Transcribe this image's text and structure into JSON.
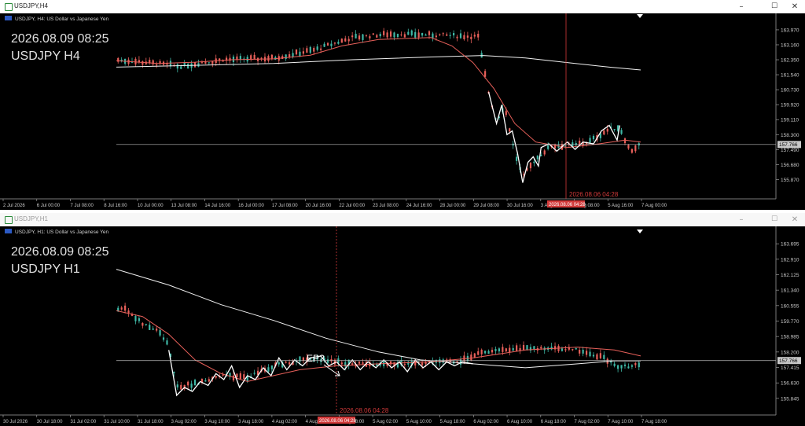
{
  "windows": [
    {
      "id": "h4",
      "window_title": "USDJPY,H4",
      "chart_header": "USDJPY, H4:  US Dollar vs Japanese Yen",
      "overlay_date": "2026.08.09 08:25",
      "overlay_symbol": "USDJPY H4",
      "crosshair_label": "2026.08.06 04:28",
      "crosshair_time_tag": "2026.08.06 04:28",
      "current_price": "157.766",
      "controls": {
        "minimize": "–",
        "maximize": "☐",
        "close": "✕"
      },
      "chart_data": {
        "type": "candlestick",
        "price_ticks": [
          "163.970",
          "163.160",
          "162.350",
          "161.540",
          "160.730",
          "159.920",
          "159.110",
          "158.300",
          "157.490",
          "156.680",
          "155.870"
        ],
        "ylim": [
          155.25,
          164.35
        ],
        "time_ticks": [
          "2 Jul 2026",
          "6 Jul 00:00",
          "7 Jul 08:00",
          "8 Jul 16:00",
          "10 Jul 00:00",
          "13 Jul 08:00",
          "14 Jul 16:00",
          "16 Jul 00:00",
          "17 Jul 08:00",
          "20 Jul 16:00",
          "22 Jul 00:00",
          "23 Jul 08:00",
          "24 Jul 16:00",
          "28 Jul 00:00",
          "29 Jul 08:00",
          "30 Jul 16:00",
          "3 Aug 00:00",
          "4 Aug 08:00",
          "5 Aug 16:00",
          "7 Aug 00:00"
        ],
        "price_line": 157.766,
        "series": [
          {
            "name": "",
            "type": "sma",
            "color": "#f0f0f0",
            "points": [
              [
                0,
                161.95
              ],
              [
                0.15,
                162.05
              ],
              [
                0.3,
                162.15
              ],
              [
                0.45,
                162.35
              ],
              [
                0.6,
                162.5
              ],
              [
                0.7,
                162.58
              ],
              [
                0.78,
                162.45
              ],
              [
                0.86,
                162.2
              ],
              [
                0.94,
                161.95
              ],
              [
                1,
                161.8
              ]
            ]
          },
          {
            "name": "",
            "type": "ema",
            "color": "#e8605a",
            "points": [
              [
                0,
                162.3
              ],
              [
                0.08,
                162.15
              ],
              [
                0.15,
                162.22
              ],
              [
                0.22,
                162.35
              ],
              [
                0.3,
                162.4
              ],
              [
                0.37,
                162.6
              ],
              [
                0.43,
                163.1
              ],
              [
                0.5,
                163.45
              ],
              [
                0.6,
                163.55
              ],
              [
                0.64,
                163.1
              ],
              [
                0.68,
                162.2
              ],
              [
                0.72,
                160.8
              ],
              [
                0.76,
                158.9
              ],
              [
                0.8,
                157.9
              ],
              [
                0.86,
                157.6
              ],
              [
                0.92,
                157.8
              ],
              [
                0.97,
                158.0
              ],
              [
                1,
                157.9
              ]
            ]
          },
          {
            "name": "",
            "type": "zigzag",
            "color": "#ffffff",
            "points": [
              [
                0.71,
                160.6
              ],
              [
                0.725,
                158.9
              ],
              [
                0.735,
                159.9
              ],
              [
                0.745,
                158.3
              ],
              [
                0.755,
                158.5
              ],
              [
                0.765,
                157.3
              ],
              [
                0.775,
                155.7
              ],
              [
                0.785,
                156.8
              ],
              [
                0.795,
                157.1
              ],
              [
                0.805,
                156.6
              ],
              [
                0.81,
                157.6
              ],
              [
                0.825,
                157.8
              ],
              [
                0.84,
                157.4
              ],
              [
                0.86,
                157.9
              ],
              [
                0.875,
                157.5
              ],
              [
                0.89,
                157.9
              ],
              [
                0.91,
                157.8
              ],
              [
                0.925,
                158.5
              ],
              [
                0.94,
                158.8
              ],
              [
                0.955,
                158.0
              ],
              [
                0.96,
                158.8
              ]
            ]
          }
        ]
      }
    },
    {
      "id": "h1",
      "window_title": "USDJPY,H1",
      "chart_header": "USDJPY, H1:  US Dollar vs Japanese Yen",
      "overlay_date": "2026.08.09 08:25",
      "overlay_symbol": "USDJPY H1",
      "crosshair_label": "2026.08.06 04:28",
      "crosshair_time_tag": "2026.08.06 04:28",
      "annotation": "EP?",
      "current_price": "157.766",
      "controls": {
        "minimize": "–",
        "maximize": "☐",
        "close": "✕"
      },
      "chart_data": {
        "type": "candlestick",
        "price_ticks": [
          "163.695",
          "162.910",
          "162.125",
          "161.340",
          "160.555",
          "159.770",
          "158.985",
          "158.200",
          "157.415",
          "156.630",
          "155.845"
        ],
        "ylim": [
          155.4,
          164.1
        ],
        "time_ticks": [
          "30 Jul 2026",
          "30 Jul 18:00",
          "31 Jul 02:00",
          "31 Jul 10:00",
          "31 Jul 18:00",
          "3 Aug 02:00",
          "3 Aug 10:00",
          "3 Aug 18:00",
          "4 Aug 02:00",
          "4 Aug 10:00",
          "4 Aug 18:00",
          "5 Aug 02:00",
          "5 Aug 10:00",
          "5 Aug 18:00",
          "6 Aug 02:00",
          "6 Aug 10:00",
          "6 Aug 18:00",
          "7 Aug 02:00",
          "7 Aug 10:00",
          "7 Aug 18:00"
        ],
        "price_line": 157.766,
        "series": [
          {
            "name": "",
            "type": "sma",
            "color": "#f0f0f0",
            "points": [
              [
                0,
                162.4
              ],
              [
                0.1,
                161.6
              ],
              [
                0.2,
                160.6
              ],
              [
                0.3,
                159.8
              ],
              [
                0.4,
                158.9
              ],
              [
                0.5,
                158.2
              ],
              [
                0.58,
                157.8
              ],
              [
                0.68,
                157.6
              ],
              [
                0.78,
                157.4
              ],
              [
                0.88,
                157.6
              ],
              [
                0.95,
                157.75
              ],
              [
                1,
                157.75
              ]
            ]
          },
          {
            "name": "",
            "type": "ema",
            "color": "#e8605a",
            "points": [
              [
                0,
                160.3
              ],
              [
                0.05,
                160.0
              ],
              [
                0.1,
                159.1
              ],
              [
                0.15,
                157.8
              ],
              [
                0.2,
                157.1
              ],
              [
                0.25,
                156.7
              ],
              [
                0.3,
                157.0
              ],
              [
                0.35,
                157.3
              ],
              [
                0.42,
                157.5
              ],
              [
                0.5,
                157.6
              ],
              [
                0.6,
                157.7
              ],
              [
                0.68,
                157.9
              ],
              [
                0.78,
                158.3
              ],
              [
                0.88,
                158.45
              ],
              [
                0.95,
                158.3
              ],
              [
                1,
                158.0
              ]
            ]
          },
          {
            "name": "",
            "type": "zigzag",
            "color": "#ffffff",
            "points": [
              [
                0.1,
                158.3
              ],
              [
                0.115,
                156.0
              ],
              [
                0.13,
                156.4
              ],
              [
                0.145,
                156.2
              ],
              [
                0.16,
                156.7
              ],
              [
                0.175,
                156.5
              ],
              [
                0.19,
                157.1
              ],
              [
                0.205,
                156.8
              ],
              [
                0.22,
                157.5
              ],
              [
                0.235,
                156.4
              ],
              [
                0.25,
                157.0
              ],
              [
                0.265,
                156.8
              ],
              [
                0.28,
                157.4
              ],
              [
                0.295,
                157.0
              ],
              [
                0.31,
                157.9
              ],
              [
                0.325,
                157.3
              ],
              [
                0.34,
                157.8
              ],
              [
                0.355,
                157.5
              ],
              [
                0.37,
                157.9
              ],
              [
                0.39,
                158.0
              ],
              [
                0.405,
                157.5
              ],
              [
                0.42,
                157.7
              ],
              [
                0.435,
                157.3
              ],
              [
                0.45,
                157.8
              ],
              [
                0.465,
                157.3
              ],
              [
                0.48,
                157.7
              ],
              [
                0.495,
                157.4
              ],
              [
                0.51,
                157.8
              ],
              [
                0.525,
                157.4
              ],
              [
                0.54,
                157.7
              ],
              [
                0.555,
                157.2
              ],
              [
                0.57,
                157.8
              ],
              [
                0.585,
                157.4
              ],
              [
                0.6,
                157.7
              ],
              [
                0.615,
                157.3
              ],
              [
                0.63,
                157.7
              ],
              [
                0.645,
                157.5
              ],
              [
                0.66,
                157.7
              ],
              [
                0.68,
                157.6
              ]
            ]
          }
        ]
      }
    }
  ]
}
